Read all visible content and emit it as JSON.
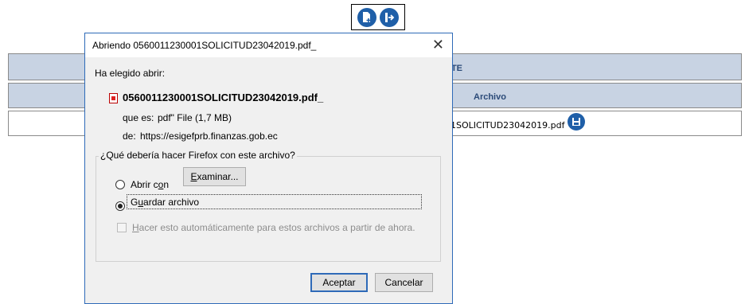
{
  "toolbar": {
    "icons": [
      "add-document-icon",
      "exit-icon"
    ]
  },
  "table": {
    "header_partial": "NTE",
    "column_header": "Archivo",
    "row_file_partial": "01SOLICITUD23042019.pdf"
  },
  "dialog": {
    "title": "Abriendo 0560011230001SOLICITUD23042019.pdf_",
    "close_label": "✕",
    "intro": "Ha elegido abrir:",
    "filename": "0560011230001SOLICITUD23042019.pdf_",
    "type_label": "que es:",
    "type_value": "pdf\" File (1,7 MB)",
    "from_label": "de:",
    "from_value": "https://esigefprb.finanzas.gob.ec",
    "question": "¿Qué debería hacer Firefox con este archivo?",
    "open_with_pre": "Abrir c",
    "open_with_u": "o",
    "open_with_post": "n",
    "browse_u": "E",
    "browse_rest": "xaminar...",
    "save_u": "u",
    "save_pre": "G",
    "save_post": "ardar archivo",
    "auto_pre": "",
    "auto_u": "H",
    "auto_post": "acer esto automáticamente para estos archivos a partir de ahora.",
    "accept": "Aceptar",
    "cancel": "Cancelar",
    "selected_option": "save"
  },
  "colors": {
    "accent": "#2e6ab8",
    "header_bg": "#c8d3e3",
    "icon_blue": "#1f5fa8"
  }
}
